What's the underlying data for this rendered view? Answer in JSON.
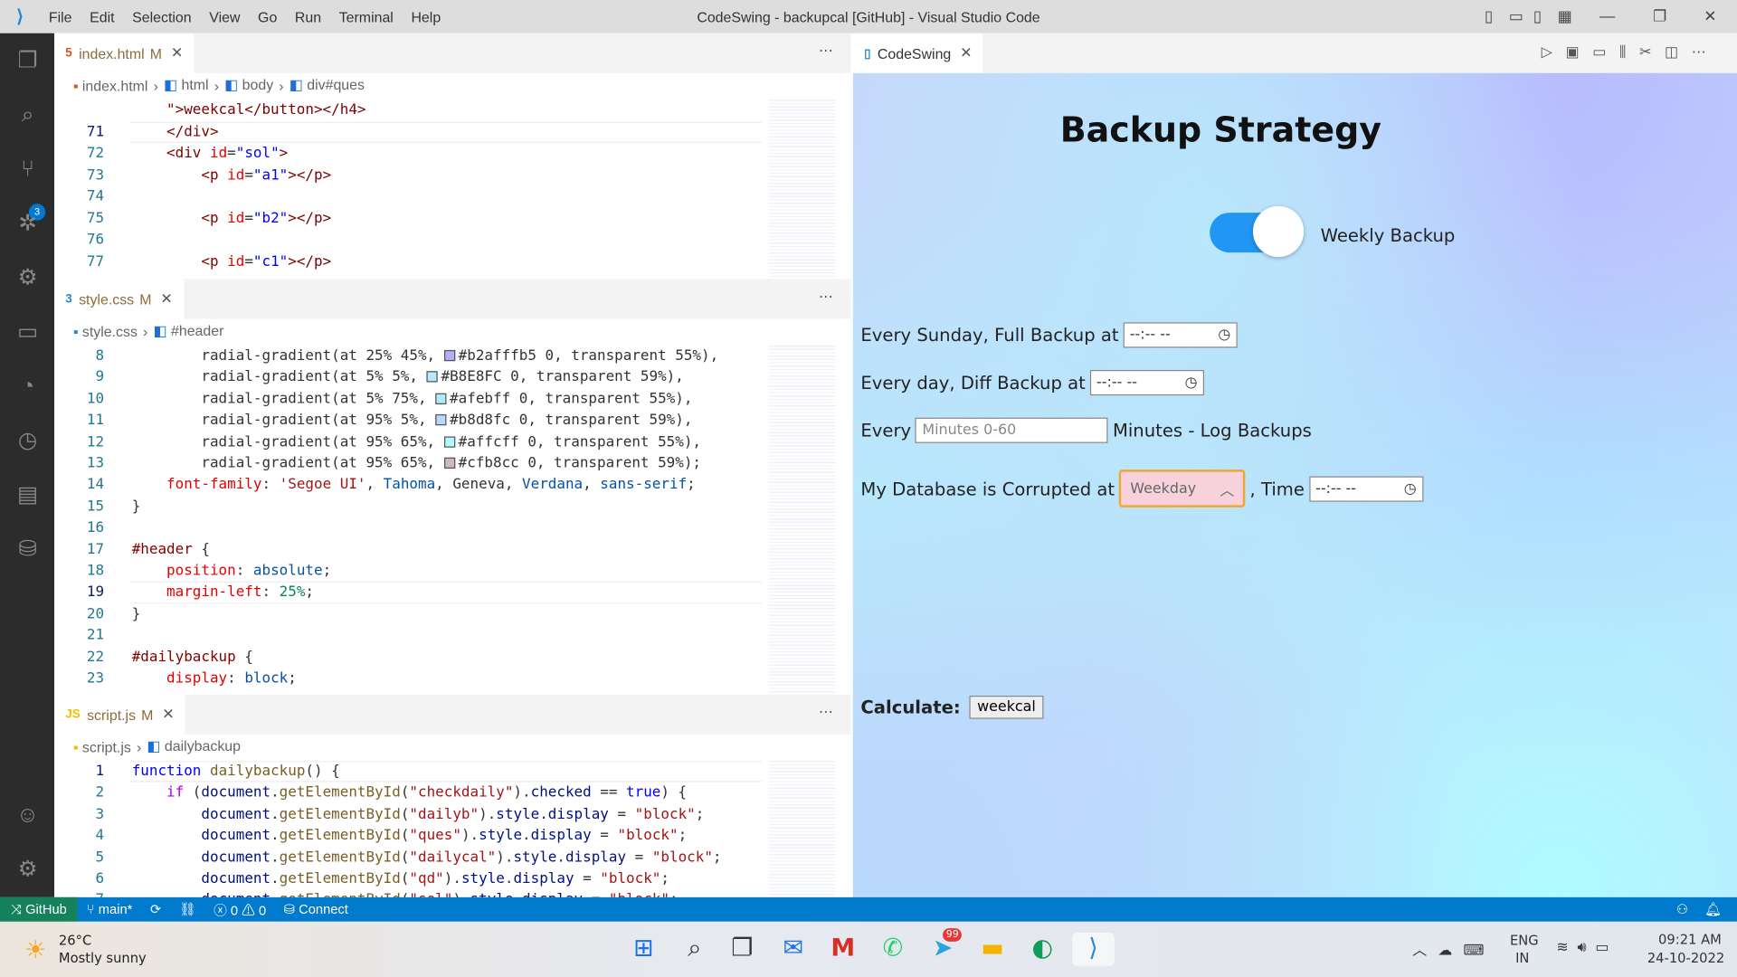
{
  "window": {
    "title": "CodeSwing - backupcal [GitHub] - Visual Studio Code",
    "menu": [
      "File",
      "Edit",
      "Selection",
      "View",
      "Go",
      "Run",
      "Terminal",
      "Help"
    ]
  },
  "activity": {
    "scm_badge": "3"
  },
  "editors": [
    {
      "tab": "index.html",
      "modified": "M",
      "crumbs": [
        "index.html",
        "html",
        "body",
        "div#ques"
      ],
      "file_icon": "5",
      "lines": [
        {
          "n": "",
          "c": [
            [
              "p",
              "    "
            ],
            [
              "t",
              "\">weekcal</button></h4>"
            ]
          ]
        },
        {
          "n": "71",
          "c": [
            [
              "p",
              "    "
            ],
            [
              "t",
              "</div>"
            ]
          ]
        },
        {
          "n": "72",
          "c": [
            [
              "p",
              "    "
            ],
            [
              "t",
              "<div "
            ],
            [
              "a",
              "id"
            ],
            [
              "p",
              "="
            ],
            [
              "s",
              "\"sol\""
            ],
            [
              "t",
              ">"
            ]
          ]
        },
        {
          "n": "73",
          "c": [
            [
              "p",
              "        "
            ],
            [
              "t",
              "<p "
            ],
            [
              "a",
              "id"
            ],
            [
              "p",
              "="
            ],
            [
              "s",
              "\"a1\""
            ],
            [
              "t",
              "></p>"
            ]
          ]
        },
        {
          "n": "74",
          "c": []
        },
        {
          "n": "75",
          "c": [
            [
              "p",
              "        "
            ],
            [
              "t",
              "<p "
            ],
            [
              "a",
              "id"
            ],
            [
              "p",
              "="
            ],
            [
              "s",
              "\"b2\""
            ],
            [
              "t",
              "></p>"
            ]
          ]
        },
        {
          "n": "76",
          "c": []
        },
        {
          "n": "77",
          "c": [
            [
              "p",
              "        "
            ],
            [
              "t",
              "<p "
            ],
            [
              "a",
              "id"
            ],
            [
              "p",
              "="
            ],
            [
              "s",
              "\"c1\""
            ],
            [
              "t",
              "></p>"
            ]
          ]
        }
      ]
    },
    {
      "tab": "style.css",
      "modified": "M",
      "crumbs": [
        "style.css",
        "#header"
      ],
      "file_icon": "3",
      "lines": [
        {
          "n": "8",
          "c": [
            [
              "p",
              "        radial-gradient(at 25% 45%, "
            ],
            [
              "sw",
              "#b2afff"
            ],
            [
              "p",
              "#b2afffb5 0, transparent 55%),"
            ]
          ]
        },
        {
          "n": "9",
          "c": [
            [
              "p",
              "        radial-gradient(at 5% 5%, "
            ],
            [
              "sw",
              "#B8E8FC"
            ],
            [
              "p",
              "#B8E8FC 0, transparent 59%),"
            ]
          ]
        },
        {
          "n": "10",
          "c": [
            [
              "p",
              "        radial-gradient(at 5% 75%, "
            ],
            [
              "sw",
              "#afebff"
            ],
            [
              "p",
              "#afebff 0, transparent 55%),"
            ]
          ]
        },
        {
          "n": "11",
          "c": [
            [
              "p",
              "        radial-gradient(at 95% 5%, "
            ],
            [
              "sw",
              "#b8d8fc"
            ],
            [
              "p",
              "#b8d8fc 0, transparent 59%),"
            ]
          ]
        },
        {
          "n": "12",
          "c": [
            [
              "p",
              "        radial-gradient(at 95% 65%, "
            ],
            [
              "sw",
              "#affcff"
            ],
            [
              "p",
              "#affcff 0, transparent 55%),"
            ]
          ]
        },
        {
          "n": "13",
          "c": [
            [
              "p",
              "        radial-gradient(at 95% 65%, "
            ],
            [
              "sw",
              "#cfb8cc"
            ],
            [
              "p",
              "#cfb8cc 0, transparent 59%);"
            ]
          ]
        },
        {
          "n": "14",
          "c": [
            [
              "p",
              "    "
            ],
            [
              "pr",
              "font-family"
            ],
            [
              "p",
              ": "
            ],
            [
              "js",
              "'Segoe UI'"
            ],
            [
              "p",
              ", "
            ],
            [
              "val",
              "Tahoma"
            ],
            [
              "p",
              ", Geneva, "
            ],
            [
              "val",
              "Verdana"
            ],
            [
              "p",
              ", "
            ],
            [
              "val",
              "sans-serif"
            ],
            [
              "p",
              ";"
            ]
          ]
        },
        {
          "n": "15",
          "c": [
            [
              "p",
              "}"
            ]
          ]
        },
        {
          "n": "16",
          "c": []
        },
        {
          "n": "17",
          "c": [
            [
              "sel",
              "#header"
            ],
            [
              "p",
              " {"
            ]
          ]
        },
        {
          "n": "18",
          "c": [
            [
              "p",
              "    "
            ],
            [
              "pr",
              "position"
            ],
            [
              "p",
              ": "
            ],
            [
              "val",
              "absolute"
            ],
            [
              "p",
              ";"
            ]
          ]
        },
        {
          "n": "19",
          "c": [
            [
              "p",
              "    "
            ],
            [
              "pr",
              "margin-left"
            ],
            [
              "p",
              ": "
            ],
            [
              "num",
              "25%"
            ],
            [
              "p",
              ";"
            ]
          ]
        },
        {
          "n": "20",
          "c": [
            [
              "p",
              "}"
            ]
          ]
        },
        {
          "n": "21",
          "c": []
        },
        {
          "n": "22",
          "c": [
            [
              "sel",
              "#dailybackup"
            ],
            [
              "p",
              " {"
            ]
          ]
        },
        {
          "n": "23",
          "c": [
            [
              "p",
              "    "
            ],
            [
              "pr",
              "display"
            ],
            [
              "p",
              ": "
            ],
            [
              "val",
              "block"
            ],
            [
              "p",
              ";"
            ]
          ]
        }
      ]
    },
    {
      "tab": "script.js",
      "modified": "M",
      "crumbs": [
        "script.js",
        "dailybackup"
      ],
      "file_icon": "JS",
      "lines": [
        {
          "n": "1",
          "c": [
            [
              "k",
              "function "
            ],
            [
              "f",
              "dailybackup"
            ],
            [
              "p",
              "() {"
            ]
          ]
        },
        {
          "n": "2",
          "c": [
            [
              "p",
              "    "
            ],
            [
              "kf",
              "if"
            ],
            [
              "p",
              " ("
            ],
            [
              "v",
              "document"
            ],
            [
              "p",
              "."
            ],
            [
              "f",
              "getElementById"
            ],
            [
              "p",
              "("
            ],
            [
              "js",
              "\"checkdaily\""
            ],
            [
              "p",
              ")."
            ],
            [
              "v",
              "checked"
            ],
            [
              "p",
              " == "
            ],
            [
              "k",
              "true"
            ],
            [
              "p",
              ") {"
            ]
          ]
        },
        {
          "n": "3",
          "c": [
            [
              "p",
              "        "
            ],
            [
              "v",
              "document"
            ],
            [
              "p",
              "."
            ],
            [
              "f",
              "getElementById"
            ],
            [
              "p",
              "("
            ],
            [
              "js",
              "\"dailyb\""
            ],
            [
              "p",
              ")."
            ],
            [
              "v",
              "style"
            ],
            [
              "p",
              "."
            ],
            [
              "v",
              "display"
            ],
            [
              "p",
              " = "
            ],
            [
              "js",
              "\"block\""
            ],
            [
              "p",
              ";"
            ]
          ]
        },
        {
          "n": "4",
          "c": [
            [
              "p",
              "        "
            ],
            [
              "v",
              "document"
            ],
            [
              "p",
              "."
            ],
            [
              "f",
              "getElementById"
            ],
            [
              "p",
              "("
            ],
            [
              "js",
              "\"ques\""
            ],
            [
              "p",
              ")."
            ],
            [
              "v",
              "style"
            ],
            [
              "p",
              "."
            ],
            [
              "v",
              "display"
            ],
            [
              "p",
              " = "
            ],
            [
              "js",
              "\"block\""
            ],
            [
              "p",
              ";"
            ]
          ]
        },
        {
          "n": "5",
          "c": [
            [
              "p",
              "        "
            ],
            [
              "v",
              "document"
            ],
            [
              "p",
              "."
            ],
            [
              "f",
              "getElementById"
            ],
            [
              "p",
              "("
            ],
            [
              "js",
              "\"dailycal\""
            ],
            [
              "p",
              ")."
            ],
            [
              "v",
              "style"
            ],
            [
              "p",
              "."
            ],
            [
              "v",
              "display"
            ],
            [
              "p",
              " = "
            ],
            [
              "js",
              "\"block\""
            ],
            [
              "p",
              ";"
            ]
          ]
        },
        {
          "n": "6",
          "c": [
            [
              "p",
              "        "
            ],
            [
              "v",
              "document"
            ],
            [
              "p",
              "."
            ],
            [
              "f",
              "getElementById"
            ],
            [
              "p",
              "("
            ],
            [
              "js",
              "\"qd\""
            ],
            [
              "p",
              ")."
            ],
            [
              "v",
              "style"
            ],
            [
              "p",
              "."
            ],
            [
              "v",
              "display"
            ],
            [
              "p",
              " = "
            ],
            [
              "js",
              "\"block\""
            ],
            [
              "p",
              ";"
            ]
          ]
        },
        {
          "n": "7",
          "c": [
            [
              "p",
              "        "
            ],
            [
              "v",
              "document"
            ],
            [
              "p",
              "."
            ],
            [
              "f",
              "getElementById"
            ],
            [
              "p",
              "("
            ],
            [
              "js",
              "\"sol\""
            ],
            [
              "p",
              ")."
            ],
            [
              "v",
              "style"
            ],
            [
              "p",
              "."
            ],
            [
              "v",
              "display"
            ],
            [
              "p",
              " = "
            ],
            [
              "js",
              "\"block\""
            ],
            [
              "p",
              ";"
            ]
          ]
        }
      ]
    }
  ],
  "preview": {
    "tab": "CodeSwing",
    "heading": "Backup Strategy",
    "toggle_label": "Weekly Backup",
    "toggle_on": true,
    "full_label": "Every Sunday, Full Backup at",
    "time_placeholder": "--:-- --",
    "diff_label": "Every day, Diff Backup at",
    "every_label": "Every",
    "minutes_placeholder": "Minutes 0-60",
    "log_label": "Minutes - Log Backups",
    "corrupt_label": "My Database is Corrupted at",
    "select_value": "Weekday",
    "time_label": ", Time",
    "calc_label": "Calculate:",
    "calc_button": "weekcal",
    "accent": "#2196f3"
  },
  "status": {
    "remote": "GitHub",
    "branch": "main*",
    "errors": "0",
    "warnings": "0",
    "connect": "Connect"
  },
  "taskbar": {
    "temp": "26°C",
    "weather": "Mostly sunny",
    "telegram_badge": "99",
    "lang": "ENG",
    "region": "IN",
    "time": "09:21 AM",
    "date": "24-10-2022"
  }
}
